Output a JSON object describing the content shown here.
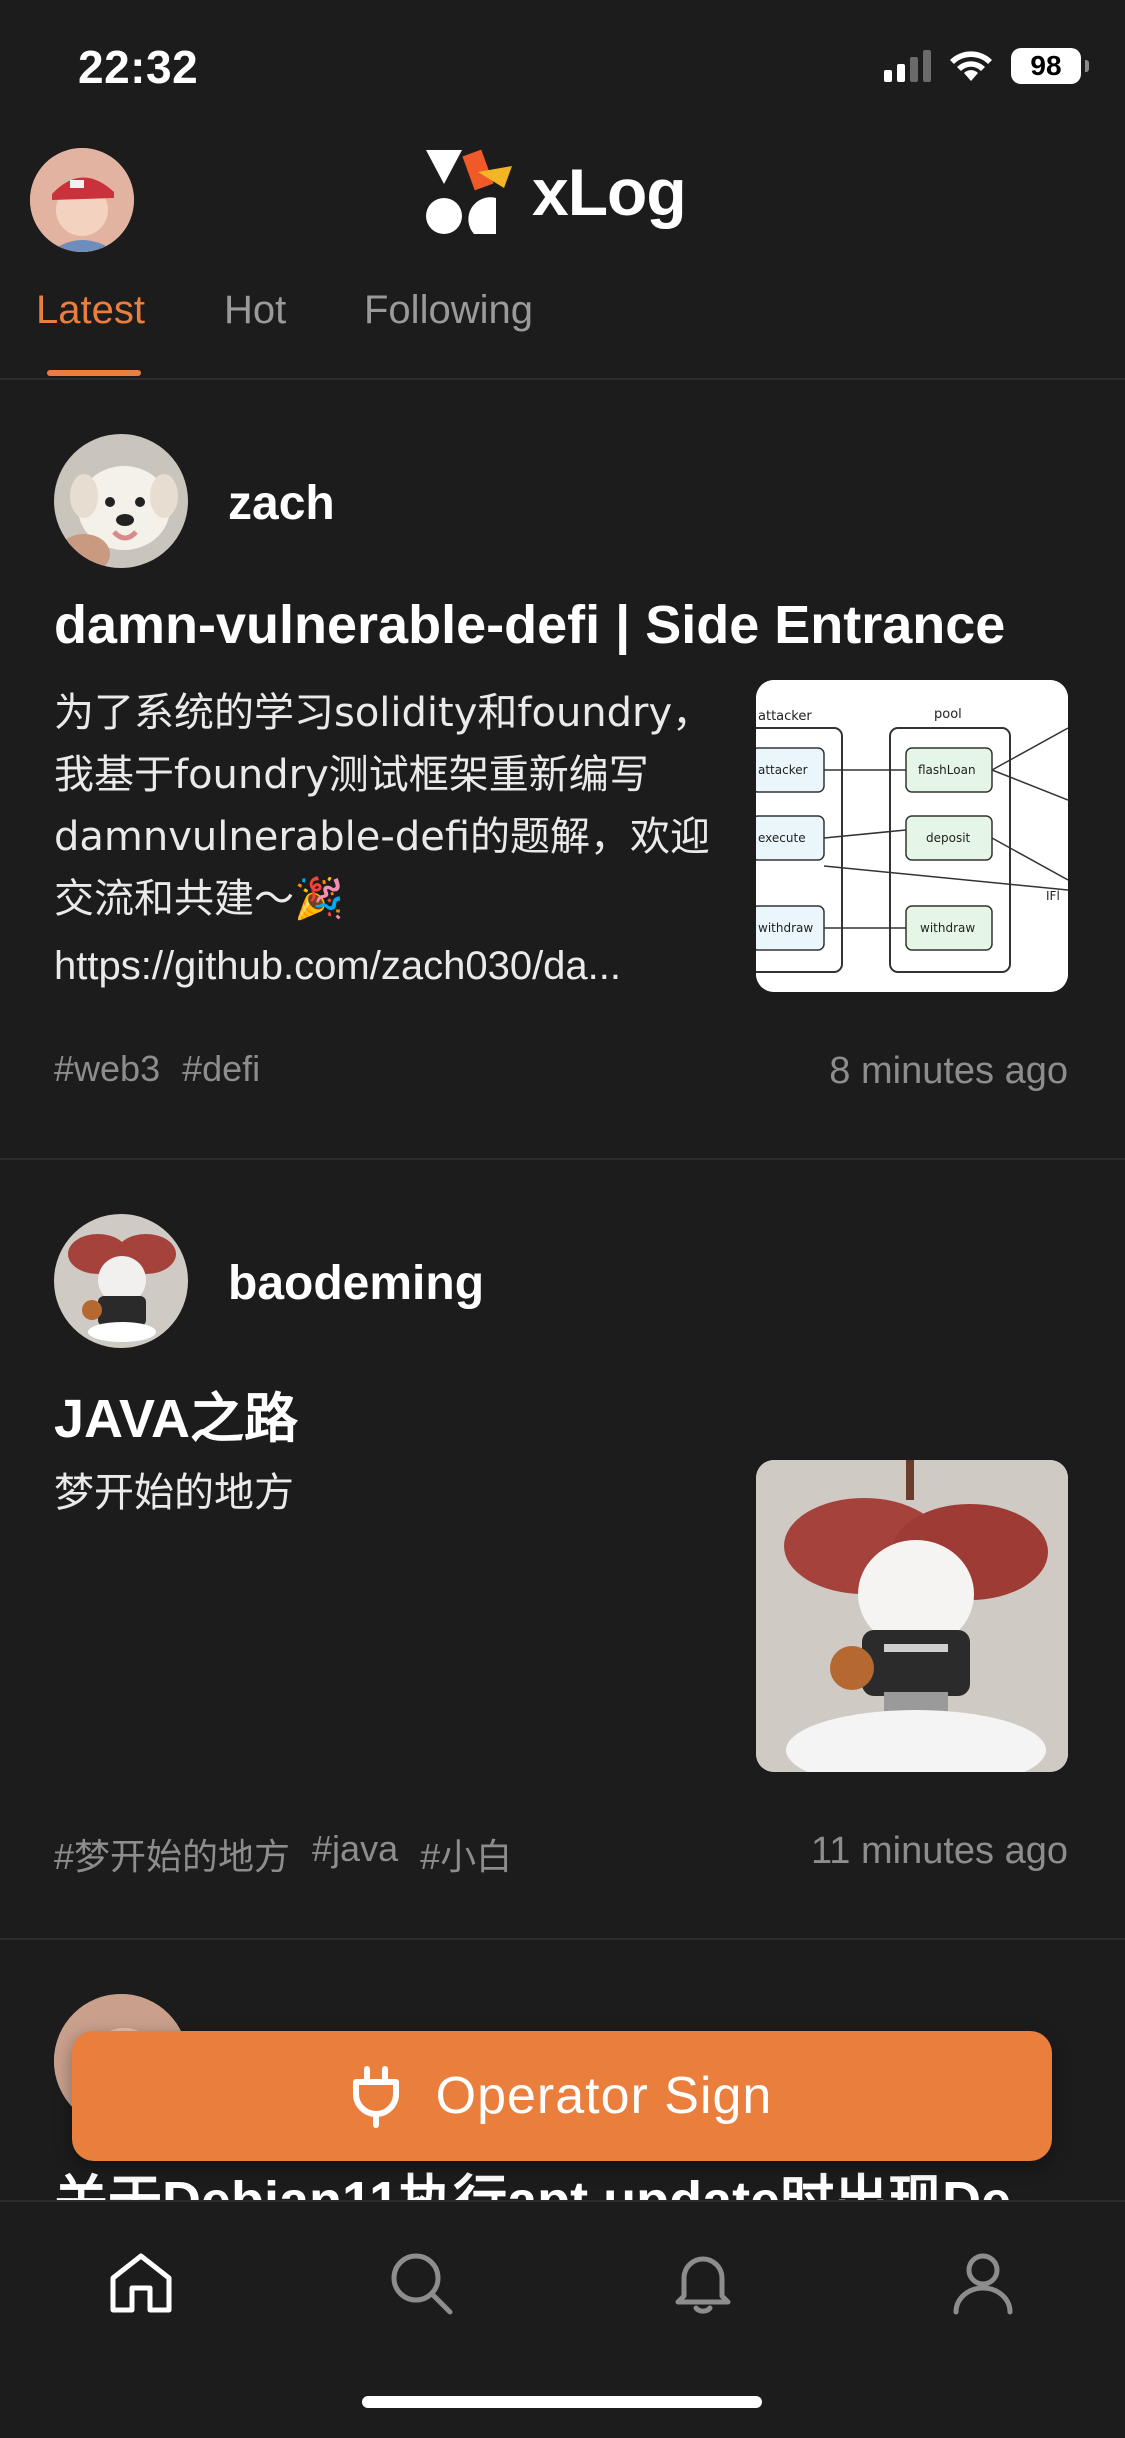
{
  "status_bar": {
    "time": "22:32",
    "battery": "98"
  },
  "header": {
    "app_name": "xLog"
  },
  "tabs": [
    {
      "label": "Latest",
      "active": true
    },
    {
      "label": "Hot",
      "active": false
    },
    {
      "label": "Following",
      "active": false
    }
  ],
  "posts": [
    {
      "author": "zach",
      "title": "damn-vulnerable-defi | Side Entrance",
      "excerpt": "为了系统的学习solidity和foundry，我基于foundry测试框架重新编写damnvulnerable-defi的题解，欢迎交流和共建～🎉",
      "link": "https://github.com/zach030/da...",
      "tags": [
        "#web3",
        "#defi"
      ],
      "time": "8 minutes ago",
      "thumb_labels": [
        "attacker",
        "pool",
        "attacker",
        "flashLoan",
        "execute",
        "deposit",
        "withdraw",
        "withdraw",
        "IFl"
      ]
    },
    {
      "author": "baodeming",
      "title": "JAVA之路",
      "excerpt": "梦开始的地方",
      "tags": [
        "#梦开始的地方",
        "#java",
        "#小白"
      ],
      "time": "11 minutes ago"
    },
    {
      "title": "关于Debian11执行apt update时出现De..."
    }
  ],
  "operator_button": {
    "label": "Operator Sign",
    "icon": "plug-icon"
  },
  "bottom_nav": [
    {
      "icon": "home-icon",
      "active": true
    },
    {
      "icon": "search-icon",
      "active": false
    },
    {
      "icon": "bell-icon",
      "active": false
    },
    {
      "icon": "profile-icon",
      "active": false
    }
  ],
  "colors": {
    "background": "#1c1c1d",
    "accent": "#e97e3d",
    "muted": "#8d8d8d",
    "divider": "#2d2d2e"
  }
}
